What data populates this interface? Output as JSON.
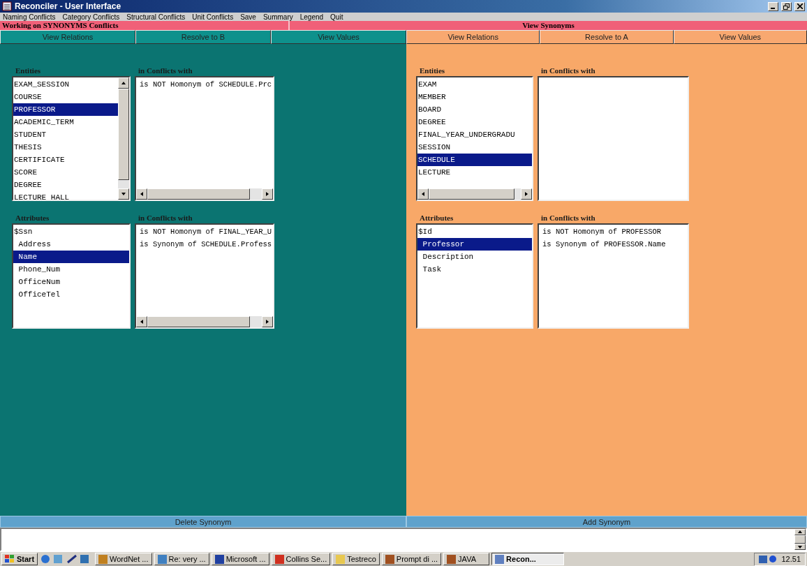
{
  "window": {
    "title": "Reconciler - User Interface"
  },
  "menu": [
    "Naming Conflicts",
    "Category Conflicts",
    "Structural Conflicts",
    "Unit Conflicts",
    "Save",
    "Summary",
    "Legend",
    "Quit"
  ],
  "header": {
    "left": "Working on SYNONYMS Conflicts",
    "right": "View Synonyms"
  },
  "panels": [
    {
      "buttons": [
        "View Relations",
        "Resolve to B",
        "View Values"
      ],
      "entities": {
        "label": "Entities",
        "items": [
          {
            "text": "EXAM_SESSION",
            "selected": false
          },
          {
            "text": "COURSE",
            "selected": false
          },
          {
            "text": "PROFESSOR",
            "selected": true
          },
          {
            "text": "ACADEMIC_TERM",
            "selected": false
          },
          {
            "text": "STUDENT",
            "selected": false
          },
          {
            "text": "THESIS",
            "selected": false
          },
          {
            "text": "CERTIFICATE",
            "selected": false
          },
          {
            "text": "SCORE",
            "selected": false
          },
          {
            "text": "DEGREE",
            "selected": false
          },
          {
            "text": "LECTURE_HALL",
            "selected": false
          }
        ]
      },
      "entity_conflicts": {
        "label": "in Conflicts with",
        "lines": [
          "is NOT Homonym of SCHEDULE.Prc"
        ]
      },
      "attributes": {
        "label": "Attributes",
        "items": [
          {
            "text": "$Ssn",
            "selected": false
          },
          {
            "text": " Address",
            "selected": false
          },
          {
            "text": " Name",
            "selected": true
          },
          {
            "text": " Phone_Num",
            "selected": false
          },
          {
            "text": " OfficeNum",
            "selected": false
          },
          {
            "text": " OfficeTel",
            "selected": false
          }
        ]
      },
      "attribute_conflicts": {
        "label": "in Conflicts with",
        "lines": [
          "is NOT Homonym of FINAL_YEAR_U",
          "is Synonym of SCHEDULE.Profess"
        ]
      },
      "action": "Delete Synonym"
    },
    {
      "buttons": [
        "View Relations",
        "Resolve to A",
        "View Values"
      ],
      "entities": {
        "label": "Entities",
        "items": [
          {
            "text": "EXAM",
            "selected": false
          },
          {
            "text": "MEMBER",
            "selected": false
          },
          {
            "text": "BOARD",
            "selected": false
          },
          {
            "text": "DEGREE",
            "selected": false
          },
          {
            "text": "FINAL_YEAR_UNDERGRADU",
            "selected": false
          },
          {
            "text": "SESSION",
            "selected": false
          },
          {
            "text": "SCHEDULE",
            "selected": true
          },
          {
            "text": "LECTURE",
            "selected": false
          }
        ]
      },
      "entity_conflicts": {
        "label": "in Conflicts with"
      },
      "attributes": {
        "label": "Attributes",
        "items": [
          {
            "text": "$Id",
            "selected": false
          },
          {
            "text": " Professor",
            "selected": true
          },
          {
            "text": " Description",
            "selected": false
          },
          {
            "text": " Task",
            "selected": false
          }
        ]
      },
      "attribute_conflicts": {
        "label": "in Conflicts with",
        "lines": [
          "is NOT Homonym of PROFESSOR",
          "is Synonym of PROFESSOR.Name"
        ]
      },
      "action": "Add Synonym"
    }
  ],
  "taskbar": {
    "start": "Start",
    "tasks": [
      {
        "label": "WordNet ...",
        "selected": false,
        "color": "#c08020"
      },
      {
        "label": "Re: very ...",
        "selected": false,
        "color": "#4080c0"
      },
      {
        "label": "Microsoft ...",
        "selected": false,
        "color": "#2040a0"
      },
      {
        "label": "Collins Se...",
        "selected": false,
        "color": "#d03020"
      },
      {
        "label": "Testreco",
        "selected": false,
        "color": "#e8c850"
      },
      {
        "label": "Prompt di ...",
        "selected": false,
        "color": "#a05020"
      },
      {
        "label": "JAVA",
        "selected": false,
        "color": "#a05020"
      },
      {
        "label": "Recon...",
        "selected": true,
        "color": "#6080c0"
      }
    ],
    "clock": "12.51"
  }
}
